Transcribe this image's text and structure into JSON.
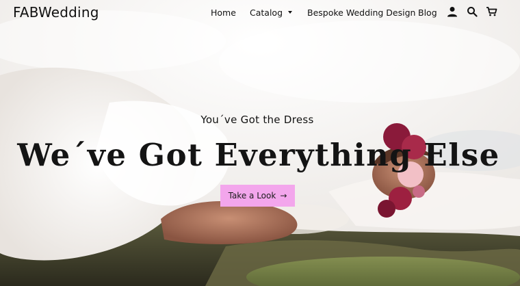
{
  "site": {
    "logo": "FABWedding"
  },
  "nav": {
    "items": [
      {
        "label": "Home"
      },
      {
        "label": "Catalog",
        "has_dropdown": true
      },
      {
        "label": "Bespoke Wedding Design"
      },
      {
        "label": "Blog"
      }
    ],
    "icons": [
      "account-icon",
      "search-icon",
      "cart-icon"
    ]
  },
  "hero": {
    "subtitle": "You´ve Got the Dress",
    "headline": "We´ve Got Everything Else",
    "cta_label": "Take a Look",
    "cta_arrow": "→",
    "accent_color": "#f3a6ec"
  }
}
